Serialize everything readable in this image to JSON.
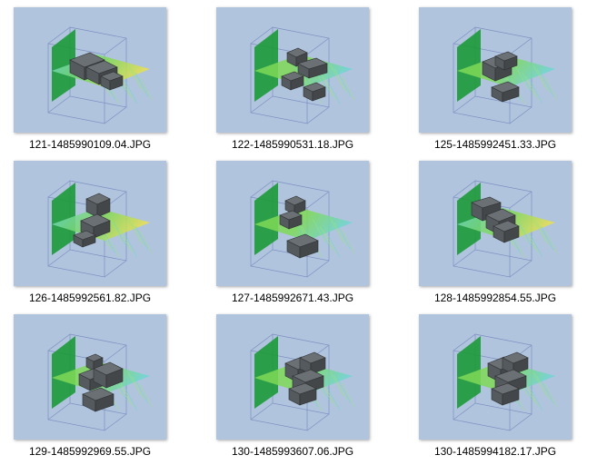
{
  "files": [
    {
      "name": "121-1485990109.04.JPG",
      "variant": 1
    },
    {
      "name": "122-1485990531.18.JPG",
      "variant": 2
    },
    {
      "name": "125-1485992451.33.JPG",
      "variant": 3
    },
    {
      "name": "126-1485992561.82.JPG",
      "variant": 4
    },
    {
      "name": "127-1485992671.43.JPG",
      "variant": 5
    },
    {
      "name": "128-1485992854.55.JPG",
      "variant": 6
    },
    {
      "name": "129-1485992969.55.JPG",
      "variant": 7
    },
    {
      "name": "130-1485993607.06.JPG",
      "variant": 8
    },
    {
      "name": "130-1485994182.17.JPG",
      "variant": 9
    }
  ],
  "colors": {
    "thumbnail_background": "#b0c4de",
    "wall_green": "#1f9a3c",
    "floor_green": "#7ed957",
    "floor_yellow": "#e8e050",
    "floor_cyan": "#6fd6d0",
    "building_gray": "#555a5e"
  }
}
